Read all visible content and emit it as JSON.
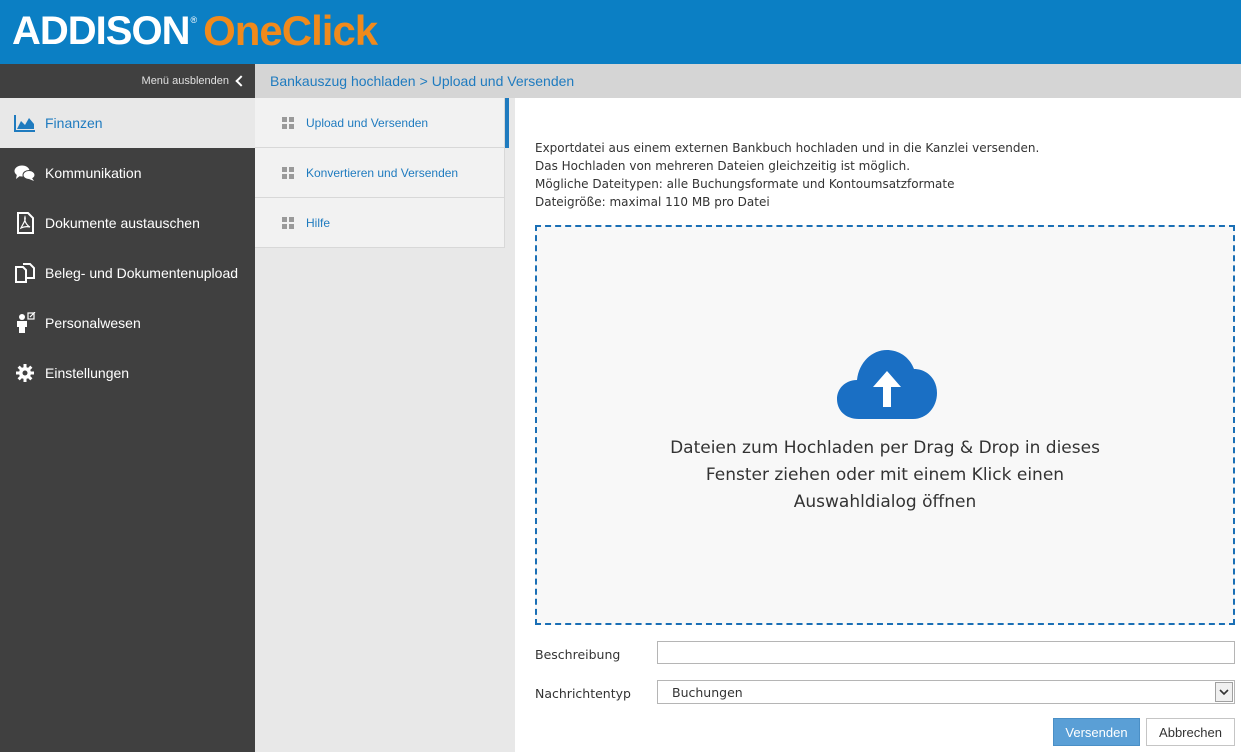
{
  "header": {
    "logo_primary": "ADDISON",
    "logo_registered": "®",
    "logo_secondary": "OneClick",
    "colors": {
      "header_bg": "#0b7fc4",
      "oneclick": "#f08a1c"
    }
  },
  "sidebar": {
    "toggle_label": "Menü ausblenden",
    "items": [
      {
        "label": "Finanzen",
        "icon": "area-chart-icon",
        "active": true
      },
      {
        "label": "Kommunikation",
        "icon": "chat-bubbles-icon",
        "active": false
      },
      {
        "label": "Dokumente austauschen",
        "icon": "pdf-document-icon",
        "active": false
      },
      {
        "label": "Beleg- und Dokumentenupload",
        "icon": "copy-documents-icon",
        "active": false
      },
      {
        "label": "Personalwesen",
        "icon": "person-external-icon",
        "active": false
      },
      {
        "label": "Einstellungen",
        "icon": "gear-icon",
        "active": false
      }
    ]
  },
  "breadcrumb": {
    "parent": "Bankauszug hochladen",
    "separator": ">",
    "current": "Upload und Versenden"
  },
  "subnav": {
    "items": [
      {
        "label": "Upload und Versenden",
        "active": true
      },
      {
        "label": "Konvertieren und Versenden",
        "active": false
      },
      {
        "label": "Hilfe",
        "active": false
      }
    ]
  },
  "main": {
    "intro_lines": [
      "Exportdatei aus einem externen Bankbuch hochladen und in die Kanzlei versenden.",
      "Das Hochladen von mehreren Dateien gleichzeitig ist möglich.",
      "Mögliche Dateitypen: alle Buchungsformate und Kontoumsatzformate",
      "Dateigröße: maximal 110 MB pro Datei"
    ],
    "dropzone": {
      "icon": "cloud-upload-icon",
      "text_lines": [
        "Dateien zum Hochladen per Drag & Drop in dieses",
        "Fenster ziehen oder mit einem Klick einen",
        "Auswahldialog öffnen"
      ]
    },
    "form": {
      "description_label": "Beschreibung",
      "description_value": "",
      "message_type_label": "Nachrichtentyp",
      "message_type_value": "Buchungen"
    },
    "buttons": {
      "send": "Versenden",
      "cancel": "Abbrechen"
    }
  }
}
